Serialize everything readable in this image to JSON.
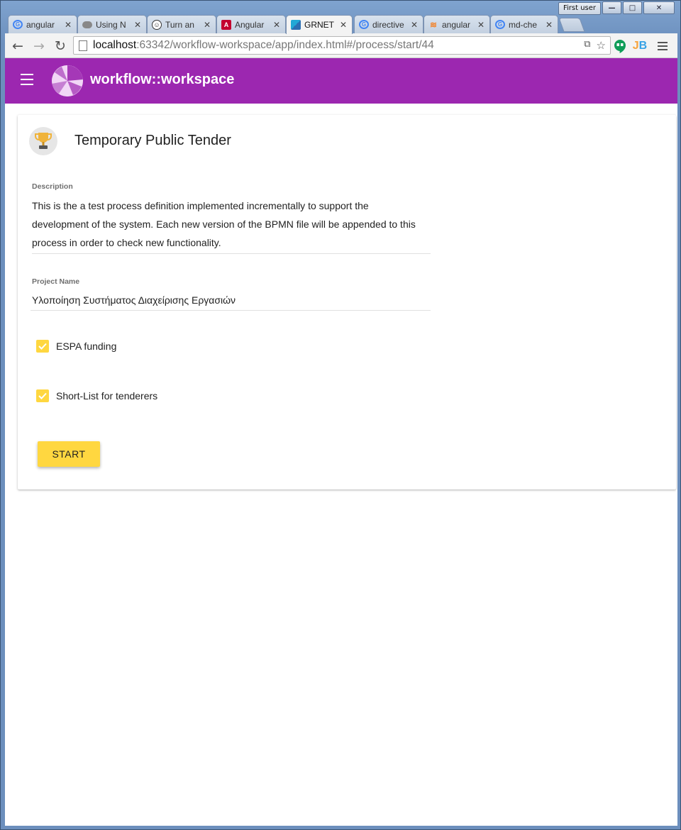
{
  "window": {
    "user_badge": "First user",
    "minimize_glyph": "—",
    "maximize_glyph": "□",
    "close_glyph": "✕"
  },
  "tabs": [
    {
      "label": "angular",
      "icon": "google-icon",
      "active": false
    },
    {
      "label": "Using N",
      "icon": "cloud-icon",
      "active": false
    },
    {
      "label": "Turn an",
      "icon": "meme-face-icon",
      "active": false
    },
    {
      "label": "Angular",
      "icon": "angular-icon",
      "active": false
    },
    {
      "label": "GRNET",
      "icon": "grnet-icon",
      "active": true
    },
    {
      "label": "directive",
      "icon": "google-icon",
      "active": false
    },
    {
      "label": "angular",
      "icon": "stackoverflow-icon",
      "active": false
    },
    {
      "label": "md-che",
      "icon": "google-icon",
      "active": false
    }
  ],
  "toolbar": {
    "url_host": "localhost",
    "url_rest": ":63342/workflow-workspace/app/index.html#/process/start/44"
  },
  "app": {
    "title": "workflow::workspace",
    "brand_color": "#9c27b0",
    "accent_color": "#ffd740"
  },
  "card": {
    "title": "Temporary Public Tender",
    "icon": "trophy-icon",
    "description_label": "Description",
    "description_lines": [
      "This is the a test process definition implemented incrementally to support the",
      "development of the system. Each new version of the BPMN file will be appended to this",
      "process in order to check new functionality."
    ],
    "project_name_label": "Project Name",
    "project_name_value": "Υλοποίηση Συστήματος Διαχείρισης Εργασιών",
    "checkboxes": [
      {
        "label": "ESPA funding",
        "checked": true
      },
      {
        "label": "Short-List for tenderers",
        "checked": true
      }
    ],
    "start_button": "START"
  }
}
